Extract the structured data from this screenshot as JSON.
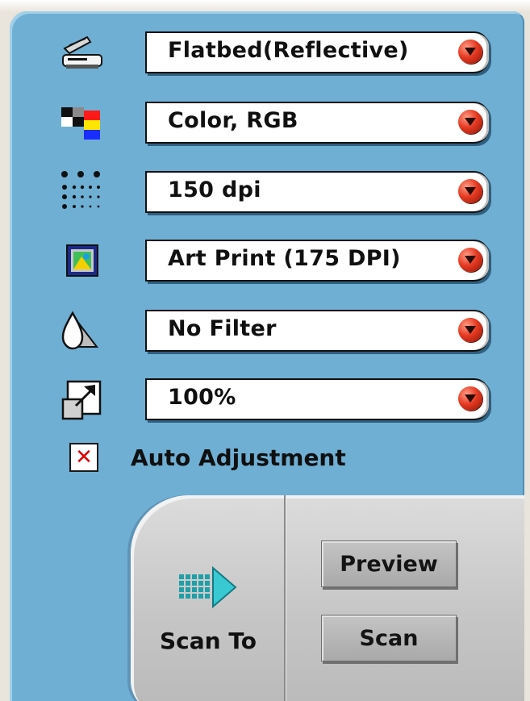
{
  "settings": [
    {
      "name": "scan-mode",
      "icon": "flatbed-scanner-icon",
      "value": "Flatbed(Reflective)"
    },
    {
      "name": "image-type",
      "icon": "color-swatch-icon",
      "value": "Color, RGB"
    },
    {
      "name": "resolution",
      "icon": "halftone-dots-icon",
      "value": "150 dpi"
    },
    {
      "name": "destination",
      "icon": "art-print-icon",
      "value": "Art Print (175 DPI)"
    },
    {
      "name": "filter",
      "icon": "ink-drop-icon",
      "value": "No Filter"
    },
    {
      "name": "scale",
      "icon": "scale-arrow-icon",
      "value": "100%"
    }
  ],
  "auto_adjustment": {
    "label": "Auto Adjustment",
    "checked": true
  },
  "actions": {
    "scan_to_label": "Scan To",
    "preview_label": "Preview",
    "scan_label": "Scan"
  },
  "colors": {
    "panel": "#6fafd3",
    "popup_arrow": "#e63a22",
    "dock": "#c6c6c6"
  }
}
